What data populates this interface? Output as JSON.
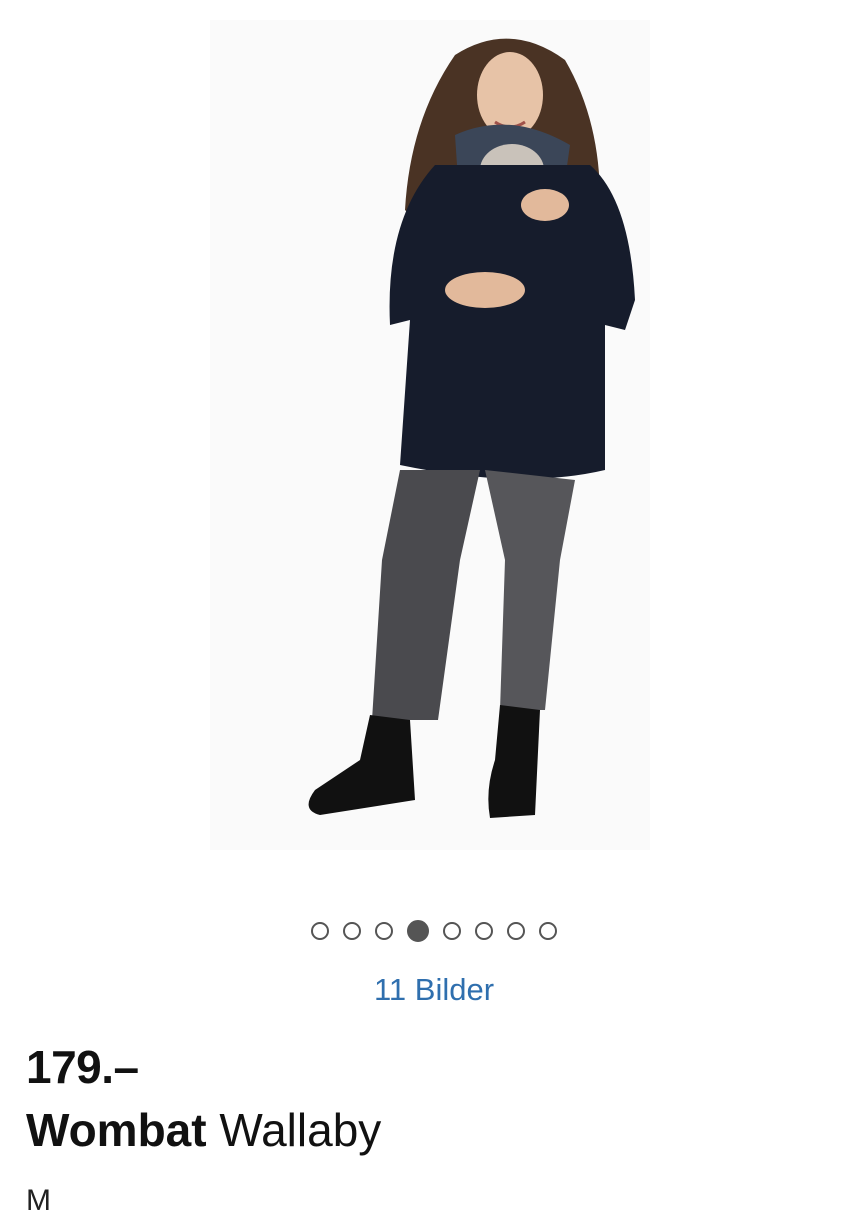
{
  "gallery": {
    "image_alt": "Wombat Wallaby Jacke",
    "image_count_label": "11 Bilder",
    "dots_total": 8,
    "active_dot_index": 3
  },
  "product": {
    "price": "179.–",
    "brand": "Wombat",
    "name": "Wallaby",
    "next_line": "M"
  },
  "colors": {
    "accent_link": "#2f6fae",
    "jacket": "#161c2c",
    "jeans": "#4a4a4e"
  }
}
